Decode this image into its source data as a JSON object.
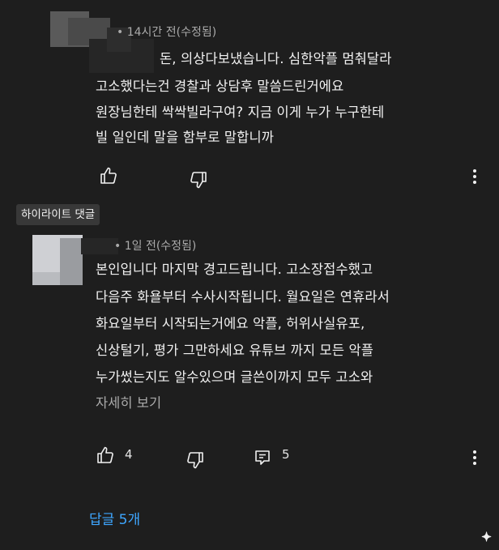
{
  "comments": [
    {
      "meta": "• 14시간 전(수정됨)",
      "lines": [
        "돈, 의상다보냈습니다. 심한악플 멈춰달라",
        "고소했다는건 경찰과 상담후 말씀드린거에요",
        "원장님한테 싹싹빌라구여?  지금 이게 누가 누구한테",
        "빌 일인데 말을 함부로 말합니까"
      ]
    },
    {
      "highlight": "하이라이트 댓글",
      "meta": "• 1일 전(수정됨)",
      "lines": [
        "본인입니다 마지막 경고드립니다. 고소장접수했고",
        "다음주 화욜부터 수사시작됩니다. 월요일은 연휴라서",
        "화요일부터 시작되는거에요 악플, 허위사실유포,",
        "신상털기, 평가 그만하세요 유튜브 까지 모든 악플",
        "누가썼는지도 알수있으며 글쓴이까지 모두 고소와"
      ],
      "more": "자세히 보기",
      "likes": "4",
      "replies_count": "5",
      "replies_link": "답글 5개"
    }
  ],
  "icons": {
    "like": "thumbs-up-icon",
    "dislike": "thumbs-down-icon",
    "reply": "reply-icon",
    "more": "more-vert-icon",
    "sparkle": "sparkle-icon"
  },
  "colors": {
    "background": "#1e1e1e",
    "text": "#f1f1f1",
    "meta": "#aaaaaa",
    "link": "#3ea6ff",
    "chip": "#383838"
  }
}
